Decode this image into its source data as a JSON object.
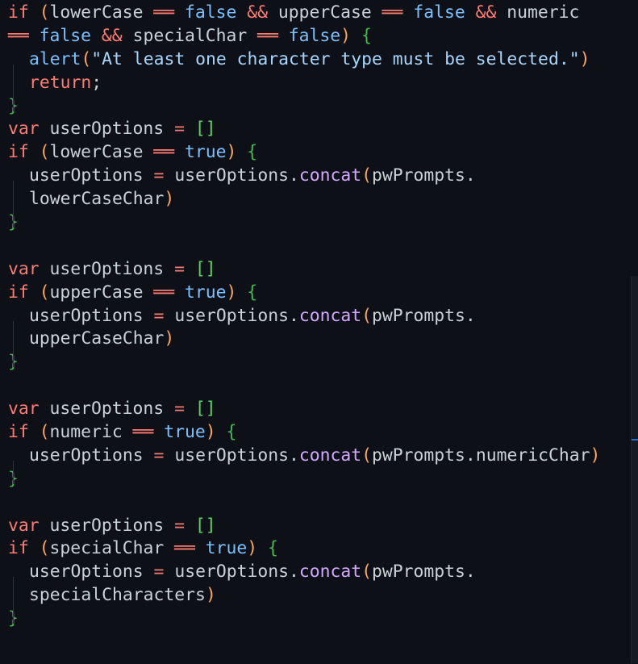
{
  "editor": {
    "lines": [
      [
        {
          "t": "if",
          "c": "kw"
        },
        {
          "t": " ",
          "c": "id"
        },
        {
          "t": "(",
          "c": "paren"
        },
        {
          "t": "lowerCase",
          "c": "id"
        },
        {
          "t": " ══ ",
          "c": "op"
        },
        {
          "t": "false",
          "c": "bool"
        },
        {
          "t": " && ",
          "c": "op"
        },
        {
          "t": "upperCase",
          "c": "id"
        },
        {
          "t": " ══ ",
          "c": "op"
        },
        {
          "t": "false",
          "c": "bool"
        },
        {
          "t": " && ",
          "c": "op"
        },
        {
          "t": "numeric",
          "c": "id"
        }
      ],
      [
        {
          "t": "══ ",
          "c": "op"
        },
        {
          "t": "false",
          "c": "bool"
        },
        {
          "t": " && ",
          "c": "op"
        },
        {
          "t": "specialChar",
          "c": "id"
        },
        {
          "t": " ══ ",
          "c": "op"
        },
        {
          "t": "false",
          "c": "bool"
        },
        {
          "t": ")",
          "c": "paren"
        },
        {
          "t": " ",
          "c": "id"
        },
        {
          "t": "{",
          "c": "brace"
        }
      ],
      [
        {
          "indent": 1
        },
        {
          "t": "alert",
          "c": "fn2"
        },
        {
          "t": "(",
          "c": "paren"
        },
        {
          "t": "\"At least one character type must be selected.\"",
          "c": "str"
        },
        {
          "t": ")",
          "c": "paren"
        }
      ],
      [
        {
          "indent": 1
        },
        {
          "t": "return",
          "c": "kw"
        },
        {
          "t": ";",
          "c": "id"
        }
      ],
      [
        {
          "t": "}",
          "c": "brace"
        }
      ],
      [
        {
          "t": "var",
          "c": "kw"
        },
        {
          "t": " userOptions ",
          "c": "id"
        },
        {
          "t": "=",
          "c": "op"
        },
        {
          "t": " ",
          "c": "id"
        },
        {
          "t": "[]",
          "c": "bracket"
        }
      ],
      [
        {
          "t": "if",
          "c": "kw"
        },
        {
          "t": " ",
          "c": "id"
        },
        {
          "t": "(",
          "c": "paren"
        },
        {
          "t": "lowerCase",
          "c": "id"
        },
        {
          "t": " ══ ",
          "c": "op"
        },
        {
          "t": "true",
          "c": "bool"
        },
        {
          "t": ")",
          "c": "paren"
        },
        {
          "t": " ",
          "c": "id"
        },
        {
          "t": "{",
          "c": "brace"
        }
      ],
      [
        {
          "indent": 1
        },
        {
          "t": "userOptions ",
          "c": "id"
        },
        {
          "t": "=",
          "c": "op"
        },
        {
          "t": " userOptions.",
          "c": "id"
        },
        {
          "t": "concat",
          "c": "fn"
        },
        {
          "t": "(",
          "c": "paren"
        },
        {
          "t": "pwPrompts.",
          "c": "id"
        }
      ],
      [
        {
          "indent": 1
        },
        {
          "t": "lowerCaseChar",
          "c": "id"
        },
        {
          "t": ")",
          "c": "paren"
        }
      ],
      [
        {
          "t": "}",
          "c": "brace"
        }
      ],
      [],
      [
        {
          "t": "var",
          "c": "kw"
        },
        {
          "t": " userOptions ",
          "c": "id"
        },
        {
          "t": "=",
          "c": "op"
        },
        {
          "t": " ",
          "c": "id"
        },
        {
          "t": "[]",
          "c": "bracket"
        }
      ],
      [
        {
          "t": "if",
          "c": "kw"
        },
        {
          "t": " ",
          "c": "id"
        },
        {
          "t": "(",
          "c": "paren"
        },
        {
          "t": "upperCase",
          "c": "id"
        },
        {
          "t": " ══ ",
          "c": "op"
        },
        {
          "t": "true",
          "c": "bool"
        },
        {
          "t": ")",
          "c": "paren"
        },
        {
          "t": " ",
          "c": "id"
        },
        {
          "t": "{",
          "c": "brace"
        }
      ],
      [
        {
          "indent": 1
        },
        {
          "t": "userOptions ",
          "c": "id"
        },
        {
          "t": "=",
          "c": "op"
        },
        {
          "t": " userOptions.",
          "c": "id"
        },
        {
          "t": "concat",
          "c": "fn"
        },
        {
          "t": "(",
          "c": "paren"
        },
        {
          "t": "pwPrompts.",
          "c": "id"
        }
      ],
      [
        {
          "indent": 1
        },
        {
          "t": "upperCaseChar",
          "c": "id"
        },
        {
          "t": ")",
          "c": "paren"
        }
      ],
      [
        {
          "t": "}",
          "c": "brace"
        }
      ],
      [],
      [
        {
          "t": "var",
          "c": "kw"
        },
        {
          "t": " userOptions ",
          "c": "id"
        },
        {
          "t": "=",
          "c": "op"
        },
        {
          "t": " ",
          "c": "id"
        },
        {
          "t": "[]",
          "c": "bracket"
        }
      ],
      [
        {
          "t": "if",
          "c": "kw"
        },
        {
          "t": " ",
          "c": "id"
        },
        {
          "t": "(",
          "c": "paren"
        },
        {
          "t": "numeric",
          "c": "id"
        },
        {
          "t": " ══ ",
          "c": "op"
        },
        {
          "t": "true",
          "c": "bool"
        },
        {
          "t": ")",
          "c": "paren"
        },
        {
          "t": " ",
          "c": "id"
        },
        {
          "t": "{",
          "c": "brace"
        }
      ],
      [
        {
          "indent": 1
        },
        {
          "t": "userOptions ",
          "c": "id"
        },
        {
          "t": "=",
          "c": "op"
        },
        {
          "t": " userOptions.",
          "c": "id"
        },
        {
          "t": "concat",
          "c": "fn"
        },
        {
          "t": "(",
          "c": "paren"
        },
        {
          "t": "pwPrompts.numericChar",
          "c": "id"
        },
        {
          "t": ")",
          "c": "paren"
        }
      ],
      [
        {
          "t": "}",
          "c": "brace"
        }
      ],
      [],
      [
        {
          "t": "var",
          "c": "kw"
        },
        {
          "t": " userOptions ",
          "c": "id"
        },
        {
          "t": "=",
          "c": "op"
        },
        {
          "t": " ",
          "c": "id"
        },
        {
          "t": "[]",
          "c": "bracket"
        }
      ],
      [
        {
          "t": "if",
          "c": "kw"
        },
        {
          "t": " ",
          "c": "id"
        },
        {
          "t": "(",
          "c": "paren"
        },
        {
          "t": "specialChar",
          "c": "id"
        },
        {
          "t": " ══ ",
          "c": "op"
        },
        {
          "t": "true",
          "c": "bool"
        },
        {
          "t": ")",
          "c": "paren"
        },
        {
          "t": " ",
          "c": "id"
        },
        {
          "t": "{",
          "c": "brace"
        }
      ],
      [
        {
          "indent": 1
        },
        {
          "t": "userOptions ",
          "c": "id"
        },
        {
          "t": "=",
          "c": "op"
        },
        {
          "t": " userOptions.",
          "c": "id"
        },
        {
          "t": "concat",
          "c": "fn"
        },
        {
          "t": "(",
          "c": "paren"
        },
        {
          "t": "pwPrompts.",
          "c": "id"
        }
      ],
      [
        {
          "indent": 1
        },
        {
          "t": "specialCharacters",
          "c": "id"
        },
        {
          "t": ")",
          "c": "paren"
        }
      ],
      [
        {
          "t": "}",
          "c": "brace"
        }
      ]
    ]
  },
  "theme": {
    "background": "#0d1117",
    "keyword": "#ff7b72",
    "boolean": "#79c0ff",
    "function": "#d2a8ff",
    "string": "#a5d6ff",
    "paren": "#ffa657",
    "brace": "#3fb950",
    "text": "#c9d1d9"
  }
}
